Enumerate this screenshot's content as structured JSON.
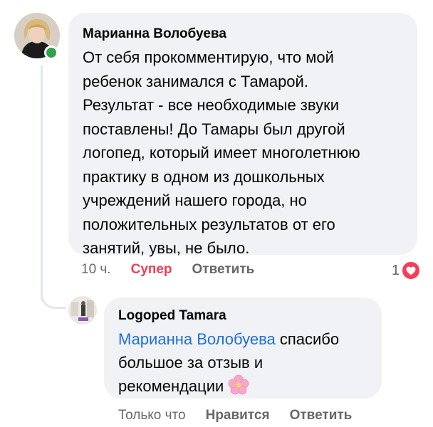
{
  "comment": {
    "author": "Марианна Волобуева",
    "lines": [
      "От себя прокомментирую, что мой",
      "ребенок занимался с Тамарой.",
      "Результат - все необходимые звуки",
      "поставлены! До Тамары был другой",
      "логопед, который имеет многолетнюю",
      "практику в одном из дошкольных",
      "учреждений нашего города, но",
      "положительных результатов от его",
      "занятий, увы, не было."
    ],
    "time": "10 ч.",
    "reaction_label": "Супер",
    "reply_label": "Ответить",
    "reaction_count": "1",
    "reaction_icon": "heart-icon",
    "online": true
  },
  "reply": {
    "author": "Logoped Tamara",
    "mention": "Марианна Волобуева",
    "lines_after_mention": [
      " спасибо",
      "большое за отзыв и",
      "рекомендации"
    ],
    "emoji_icon": "cherry-blossom-icon",
    "time": "Только что",
    "like_label": "Нравится",
    "reply_label": "Ответить"
  },
  "colors": {
    "bubble": "#f0f2f5",
    "secondary_text": "#65676b",
    "mention": "#216fdb",
    "reaction_red": "#f33e58",
    "online_green": "#31a24c"
  }
}
